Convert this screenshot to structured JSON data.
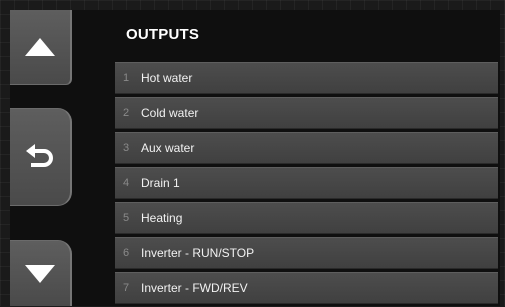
{
  "header": {
    "title": "OUTPUTS"
  },
  "nav": {
    "up_icon": "triangle-up-icon",
    "back_icon": "return-arrow-icon",
    "down_icon": "triangle-down-icon",
    "icon_color": "#ffffff"
  },
  "outputs": [
    {
      "num": "1",
      "label": "Hot water"
    },
    {
      "num": "2",
      "label": "Cold water"
    },
    {
      "num": "3",
      "label": "Aux water"
    },
    {
      "num": "4",
      "label": "Drain 1"
    },
    {
      "num": "5",
      "label": "Heating"
    },
    {
      "num": "6",
      "label": "Inverter - RUN/STOP"
    },
    {
      "num": "7",
      "label": "Inverter - FWD/REV"
    }
  ]
}
